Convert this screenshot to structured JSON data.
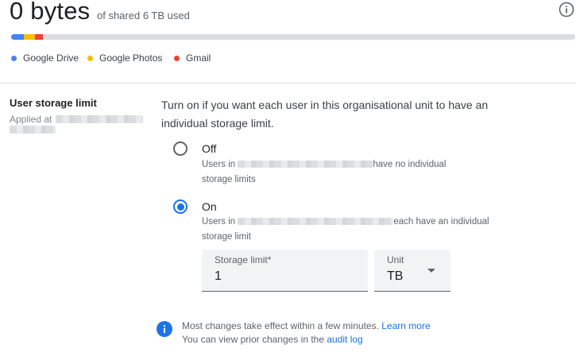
{
  "usage": {
    "amount": "0 bytes",
    "suffix": "of shared 6 TB used"
  },
  "legend": [
    {
      "label": "Google Drive",
      "color": "#4285f4"
    },
    {
      "label": "Google Photos",
      "color": "#fbbc04"
    },
    {
      "label": "Gmail",
      "color": "#ea4335"
    }
  ],
  "setting": {
    "title": "User storage limit",
    "applied_prefix": "Applied at",
    "intro_line1": "Turn on if you want each user in this organisational unit to have an",
    "intro_line2": "individual storage limit."
  },
  "options": {
    "off": {
      "label": "Off",
      "desc_prefix": "Users in",
      "desc_suffix": "have no individual",
      "desc_line2": "storage limits",
      "selected": false
    },
    "on": {
      "label": "On",
      "desc_prefix": "Users in",
      "desc_suffix": "each have an individual",
      "desc_line2": "storage limit",
      "selected": true
    }
  },
  "storage_limit": {
    "label": "Storage limit*",
    "value": "1"
  },
  "unit": {
    "label": "Unit",
    "value": "TB"
  },
  "note": {
    "line1": "Most changes take effect within a few minutes.",
    "learn_more": "Learn more",
    "line2": "You can view prior changes in the",
    "audit_log": "audit log"
  }
}
